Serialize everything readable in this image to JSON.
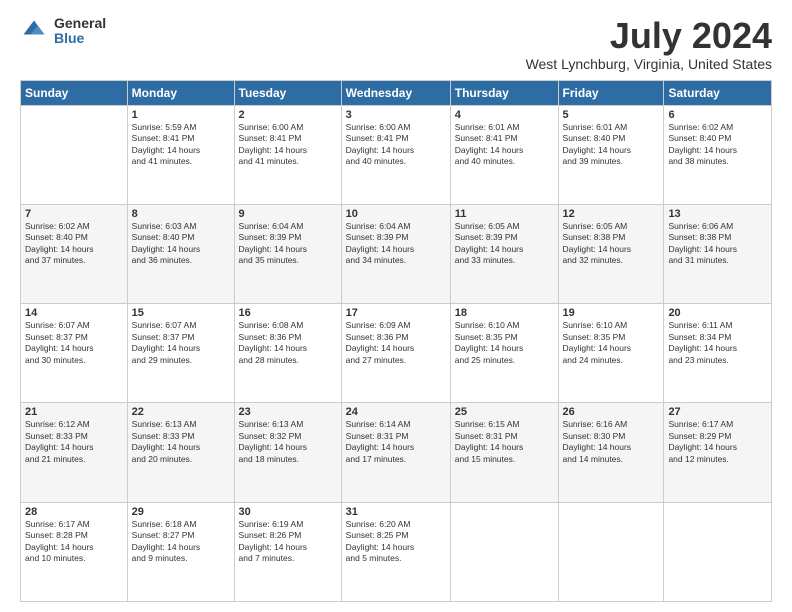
{
  "logo": {
    "general": "General",
    "blue": "Blue"
  },
  "title": "July 2024",
  "subtitle": "West Lynchburg, Virginia, United States",
  "header": {
    "days": [
      "Sunday",
      "Monday",
      "Tuesday",
      "Wednesday",
      "Thursday",
      "Friday",
      "Saturday"
    ]
  },
  "weeks": [
    [
      {
        "day": "",
        "info": ""
      },
      {
        "day": "1",
        "info": "Sunrise: 5:59 AM\nSunset: 8:41 PM\nDaylight: 14 hours\nand 41 minutes."
      },
      {
        "day": "2",
        "info": "Sunrise: 6:00 AM\nSunset: 8:41 PM\nDaylight: 14 hours\nand 41 minutes."
      },
      {
        "day": "3",
        "info": "Sunrise: 6:00 AM\nSunset: 8:41 PM\nDaylight: 14 hours\nand 40 minutes."
      },
      {
        "day": "4",
        "info": "Sunrise: 6:01 AM\nSunset: 8:41 PM\nDaylight: 14 hours\nand 40 minutes."
      },
      {
        "day": "5",
        "info": "Sunrise: 6:01 AM\nSunset: 8:40 PM\nDaylight: 14 hours\nand 39 minutes."
      },
      {
        "day": "6",
        "info": "Sunrise: 6:02 AM\nSunset: 8:40 PM\nDaylight: 14 hours\nand 38 minutes."
      }
    ],
    [
      {
        "day": "7",
        "info": "Sunrise: 6:02 AM\nSunset: 8:40 PM\nDaylight: 14 hours\nand 37 minutes."
      },
      {
        "day": "8",
        "info": "Sunrise: 6:03 AM\nSunset: 8:40 PM\nDaylight: 14 hours\nand 36 minutes."
      },
      {
        "day": "9",
        "info": "Sunrise: 6:04 AM\nSunset: 8:39 PM\nDaylight: 14 hours\nand 35 minutes."
      },
      {
        "day": "10",
        "info": "Sunrise: 6:04 AM\nSunset: 8:39 PM\nDaylight: 14 hours\nand 34 minutes."
      },
      {
        "day": "11",
        "info": "Sunrise: 6:05 AM\nSunset: 8:39 PM\nDaylight: 14 hours\nand 33 minutes."
      },
      {
        "day": "12",
        "info": "Sunrise: 6:05 AM\nSunset: 8:38 PM\nDaylight: 14 hours\nand 32 minutes."
      },
      {
        "day": "13",
        "info": "Sunrise: 6:06 AM\nSunset: 8:38 PM\nDaylight: 14 hours\nand 31 minutes."
      }
    ],
    [
      {
        "day": "14",
        "info": "Sunrise: 6:07 AM\nSunset: 8:37 PM\nDaylight: 14 hours\nand 30 minutes."
      },
      {
        "day": "15",
        "info": "Sunrise: 6:07 AM\nSunset: 8:37 PM\nDaylight: 14 hours\nand 29 minutes."
      },
      {
        "day": "16",
        "info": "Sunrise: 6:08 AM\nSunset: 8:36 PM\nDaylight: 14 hours\nand 28 minutes."
      },
      {
        "day": "17",
        "info": "Sunrise: 6:09 AM\nSunset: 8:36 PM\nDaylight: 14 hours\nand 27 minutes."
      },
      {
        "day": "18",
        "info": "Sunrise: 6:10 AM\nSunset: 8:35 PM\nDaylight: 14 hours\nand 25 minutes."
      },
      {
        "day": "19",
        "info": "Sunrise: 6:10 AM\nSunset: 8:35 PM\nDaylight: 14 hours\nand 24 minutes."
      },
      {
        "day": "20",
        "info": "Sunrise: 6:11 AM\nSunset: 8:34 PM\nDaylight: 14 hours\nand 23 minutes."
      }
    ],
    [
      {
        "day": "21",
        "info": "Sunrise: 6:12 AM\nSunset: 8:33 PM\nDaylight: 14 hours\nand 21 minutes."
      },
      {
        "day": "22",
        "info": "Sunrise: 6:13 AM\nSunset: 8:33 PM\nDaylight: 14 hours\nand 20 minutes."
      },
      {
        "day": "23",
        "info": "Sunrise: 6:13 AM\nSunset: 8:32 PM\nDaylight: 14 hours\nand 18 minutes."
      },
      {
        "day": "24",
        "info": "Sunrise: 6:14 AM\nSunset: 8:31 PM\nDaylight: 14 hours\nand 17 minutes."
      },
      {
        "day": "25",
        "info": "Sunrise: 6:15 AM\nSunset: 8:31 PM\nDaylight: 14 hours\nand 15 minutes."
      },
      {
        "day": "26",
        "info": "Sunrise: 6:16 AM\nSunset: 8:30 PM\nDaylight: 14 hours\nand 14 minutes."
      },
      {
        "day": "27",
        "info": "Sunrise: 6:17 AM\nSunset: 8:29 PM\nDaylight: 14 hours\nand 12 minutes."
      }
    ],
    [
      {
        "day": "28",
        "info": "Sunrise: 6:17 AM\nSunset: 8:28 PM\nDaylight: 14 hours\nand 10 minutes."
      },
      {
        "day": "29",
        "info": "Sunrise: 6:18 AM\nSunset: 8:27 PM\nDaylight: 14 hours\nand 9 minutes."
      },
      {
        "day": "30",
        "info": "Sunrise: 6:19 AM\nSunset: 8:26 PM\nDaylight: 14 hours\nand 7 minutes."
      },
      {
        "day": "31",
        "info": "Sunrise: 6:20 AM\nSunset: 8:25 PM\nDaylight: 14 hours\nand 5 minutes."
      },
      {
        "day": "",
        "info": ""
      },
      {
        "day": "",
        "info": ""
      },
      {
        "day": "",
        "info": ""
      }
    ]
  ]
}
